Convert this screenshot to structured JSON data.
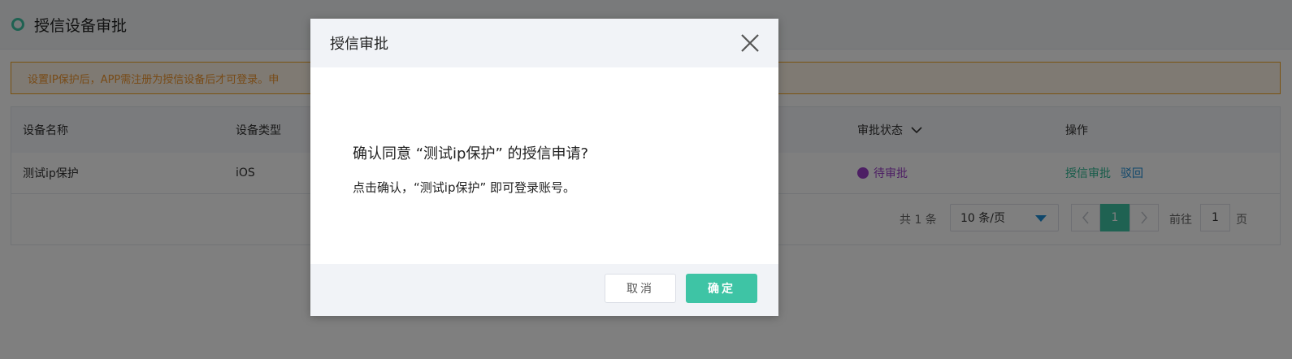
{
  "header": {
    "title": "授信设备审批"
  },
  "alert": {
    "text": "设置IP保护后，APP需注册为授信设备后才可登录。申"
  },
  "table": {
    "columns": {
      "device_name": "设备名称",
      "device_type": "设备类型",
      "approval_status": "审批状态",
      "operations": "操作"
    },
    "rows": [
      {
        "device_name": "测试ip保护",
        "device_type": "iOS",
        "status": "待审批",
        "action_approve": "授信审批",
        "action_reject": "驳回"
      }
    ]
  },
  "pagination": {
    "total": "共 1 条",
    "page_size": "10 条/页",
    "current_page": "1",
    "goto_label": "前往",
    "goto_value": "1",
    "page_unit": "页"
  },
  "modal": {
    "title": "授信审批",
    "question": "确认同意 “测试ip保护” 的授信申请?",
    "note": "点击确认，“测试ip保护” 即可登录账号。",
    "cancel_label": "取消",
    "confirm_label": "确定"
  },
  "colors": {
    "accent": "#3ec4a5",
    "status_pending": "#9b3fc9",
    "link_reject": "#1f8fd6",
    "alert_border": "#f5a623"
  }
}
